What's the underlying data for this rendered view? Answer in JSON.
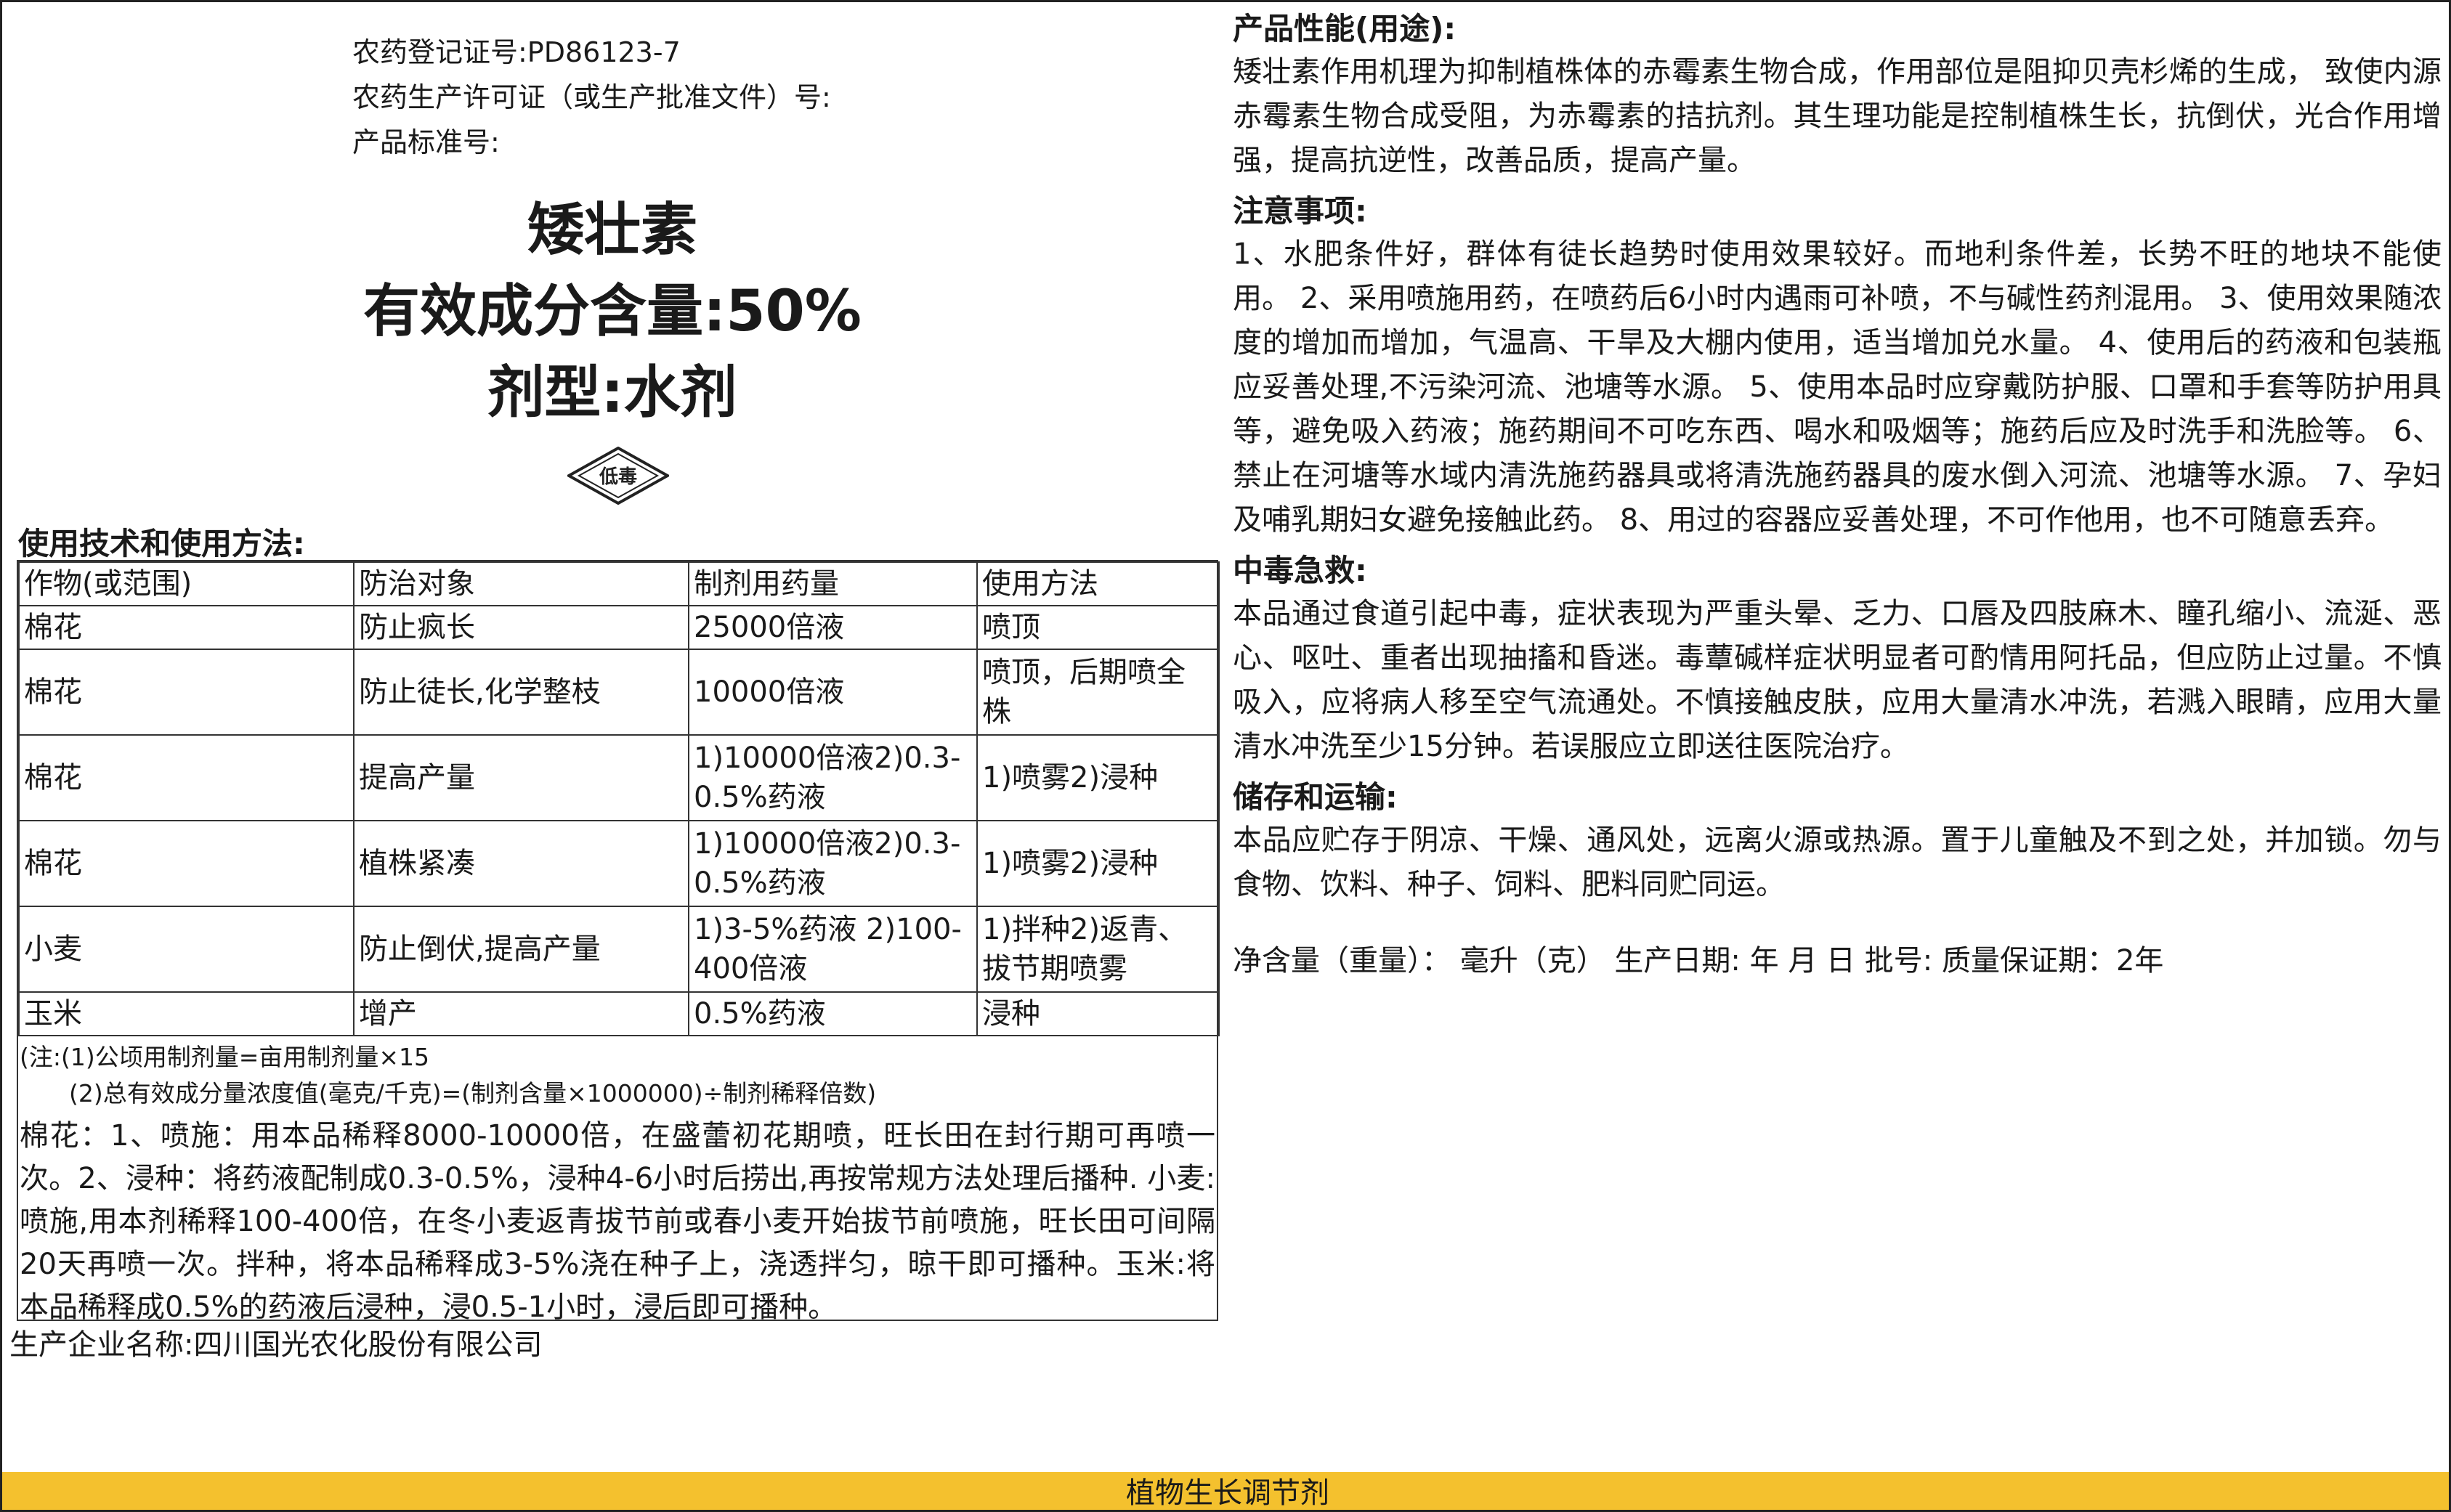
{
  "registration": {
    "reg_no": "农药登记证号:PD86123-7",
    "license": "农药生产许可证（或生产批准文件）号:",
    "standard": "产品标准号:"
  },
  "product": {
    "name": "矮壮素",
    "content": "有效成分含量:50%",
    "formulation": "剂型:水剂",
    "toxicity_badge": "低毒"
  },
  "usage": {
    "heading": "使用技术和使用方法:",
    "headers": [
      "作物(或范围)",
      "防治对象",
      "制剂用药量",
      "使用方法"
    ],
    "rows": [
      [
        "棉花",
        "防止疯长",
        "25000倍液",
        "喷顶"
      ],
      [
        "棉花",
        "防止徒长,化学整枝",
        "10000倍液",
        "喷顶，后期喷全株"
      ],
      [
        "棉花",
        "提高产量",
        "1)10000倍液2)0.3-0.5%药液",
        "1)喷雾2)浸种"
      ],
      [
        "棉花",
        "植株紧凑",
        "1)10000倍液2)0.3-0.5%药液",
        "1)喷雾2)浸种"
      ],
      [
        "小麦",
        "防止倒伏,提高产量",
        "1)3-5%药液 2)100-400倍液",
        "1)拌种2)返青、拔节期喷雾"
      ],
      [
        "玉米",
        "增产",
        "0.5%药液",
        "浸种"
      ]
    ],
    "note1": "(注:(1)公顷用制剂量=亩用制剂量×15",
    "note2": "(2)总有效成分量浓度值(毫克/千克)=(制剂含量×1000000)÷制剂稀释倍数)",
    "directions": "棉花：1、喷施：用本品稀释8000-10000倍，在盛蕾初花期喷，旺长田在封行期可再喷一次。2、浸种：将药液配制成0.3-0.5%，浸种4-6小时后捞出,再按常规方法处理后播种. 小麦:喷施,用本剂稀释100-400倍，在冬小麦返青拔节前或春小麦开始拔节前喷施，旺长田可间隔20天再喷一次。拌种，将本品稀释成3-5%浇在种子上，浇透拌匀，晾干即可播种。玉米:将本品稀释成0.5%的药液后浸种，浸0.5-1小时，浸后即可播种。"
  },
  "manufacturer": "生产企业名称:四川国光农化股份有限公司",
  "performance": {
    "heading": "产品性能(用途):",
    "text": "矮壮素作用机理为抑制植株体的赤霉素生物合成，作用部位是阻抑贝壳杉烯的生成， 致使内源赤霉素生物合成受阻，为赤霉素的拮抗剂。其生理功能是控制植株生长，抗倒伏，光合作用增强，提高抗逆性，改善品质，提高产量。"
  },
  "precautions": {
    "heading": "注意事项:",
    "text": "1、水肥条件好，群体有徒长趋势时使用效果较好。而地利条件差，长势不旺的地块不能使用。 2、采用喷施用药，在喷药后6小时内遇雨可补喷，不与碱性药剂混用。 3、使用效果随浓度的增加而增加，气温高、干旱及大棚内使用，适当增加兑水量。 4、使用后的药液和包装瓶应妥善处理,不污染河流、池塘等水源。 5、使用本品时应穿戴防护服、口罩和手套等防护用具等，避免吸入药液；施药期间不可吃东西、喝水和吸烟等；施药后应及时洗手和洗脸等。 6、禁止在河塘等水域内清洗施药器具或将清洗施药器具的废水倒入河流、池塘等水源。 7、孕妇及哺乳期妇女避免接触此药。 8、用过的容器应妥善处理，不可作他用，也不可随意丢弃。"
  },
  "first_aid": {
    "heading": "中毒急救:",
    "text": "本品通过食道引起中毒，症状表现为严重头晕、乏力、口唇及四肢麻木、瞳孔缩小、流涎、恶心、呕吐、重者出现抽搐和昏迷。毒蕈碱样症状明显者可酌情用阿托品，但应防止过量。不慎吸入，应将病人移至空气流通处。不慎接触皮肤，应用大量清水冲洗，若溅入眼睛，应用大量清水冲洗至少15分钟。若误服应立即送往医院治疗。"
  },
  "storage": {
    "heading": "储存和运输:",
    "text": "本品应贮存于阴凉、干燥、通风处，远离火源或热源。置于儿童触及不到之处，并加锁。勿与食物、饮料、种子、饲料、肥料同贮同运。"
  },
  "net_line": "净含量（重量）：  毫升（克）  生产日期: 年  月  日  批号: 质量保证期：2年",
  "bottom_band": "植物生长调节剂",
  "colors": {
    "band": "#f4c12e",
    "border": "#222222"
  }
}
